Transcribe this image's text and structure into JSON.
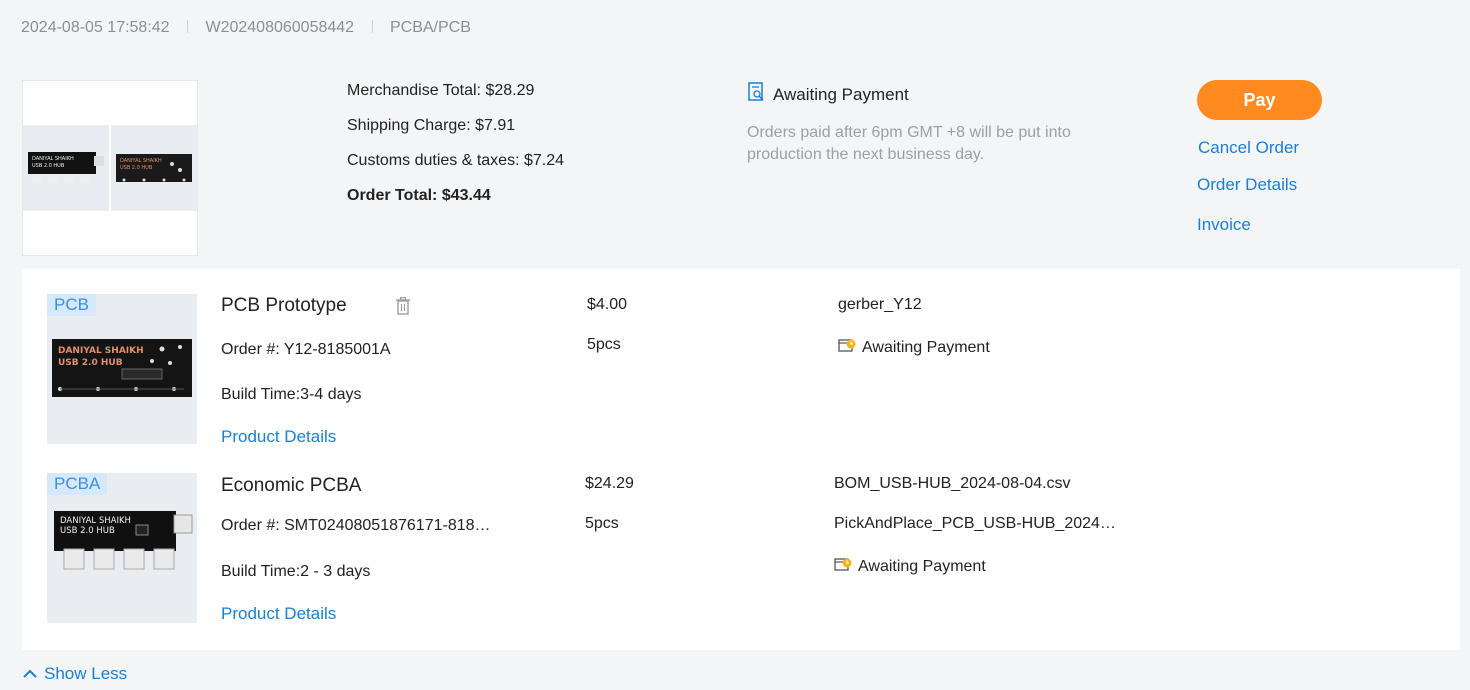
{
  "order": {
    "datetime": "2024-08-05 17:58:42",
    "number": "W202408060058442",
    "type": "PCBA/PCB"
  },
  "summary": {
    "merchandise_total": "Merchandise Total: $28.29",
    "shipping_charge": "Shipping Charge: $7.91",
    "customs": "Customs duties & taxes: $7.24",
    "order_total": "Order Total: $43.44"
  },
  "status": {
    "label": "Awaiting Payment",
    "note": "Orders paid after 6pm GMT +8 will be put into production the next business day."
  },
  "actions": {
    "pay": "Pay",
    "cancel": "Cancel Order",
    "details": "Order Details",
    "invoice": "Invoice"
  },
  "items": [
    {
      "tag": "PCB",
      "title": "PCB Prototype",
      "order_no": "Order #: Y12-8185001A",
      "build_time": "Build Time:3-4 days",
      "details_link": "Product Details",
      "price": "$4.00",
      "qty": "5pcs",
      "files": [
        "gerber_Y12"
      ],
      "status": "Awaiting Payment",
      "board_text": [
        "DANIYAL SHAIKH",
        "USB 2.0 HUB"
      ]
    },
    {
      "tag": "PCBA",
      "title": "Economic PCBA",
      "order_no": "Order #: SMT02408051876171-818…",
      "build_time": "Build Time:2 - 3 days",
      "details_link": "Product Details",
      "price": "$24.29",
      "qty": "5pcs",
      "files": [
        "BOM_USB-HUB_2024-08-04.csv",
        "PickAndPlace_PCB_USB-HUB_2024…"
      ],
      "status": "Awaiting Payment",
      "board_text": [
        "DANIYAL SHAIKH",
        "USB 2.0 HUB"
      ]
    }
  ],
  "footer": {
    "show_less": "Show Less"
  },
  "colors": {
    "accent": "#1a7fd4",
    "pay": "#ff8a1f",
    "tag_bg": "#d6e8fb"
  }
}
